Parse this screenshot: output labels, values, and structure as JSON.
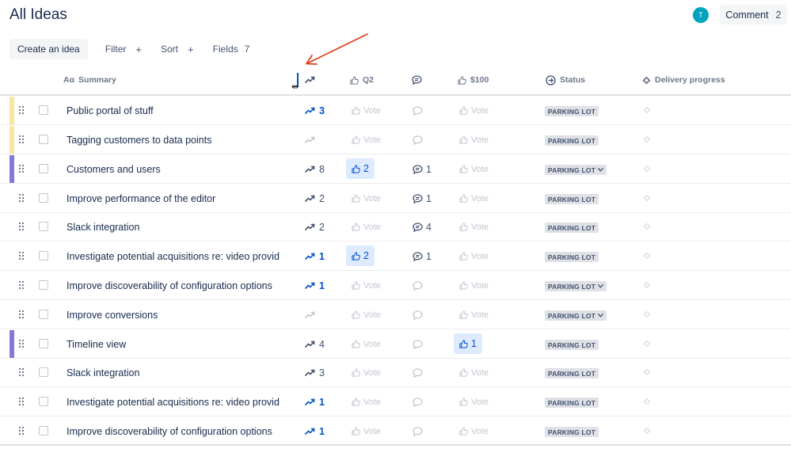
{
  "page": {
    "title": "All Ideas"
  },
  "header_actions": {
    "avatar_initial": "T",
    "comment_label": "Comment",
    "comment_count": "2"
  },
  "toolbar": {
    "create_label": "Create an idea",
    "filter_label": "Filter",
    "filter_plus": "+",
    "sort_label": "Sort",
    "sort_plus": "+",
    "fields_label": "Fields",
    "fields_count": "7"
  },
  "columns": {
    "summary": "Summary",
    "summary_prefix": "Aα",
    "q2": "Q2",
    "usd100": "$100",
    "status": "Status",
    "delivery": "Delivery progress"
  },
  "vote_placeholder": "Vote",
  "colors": {
    "stripe_yellow": "#f8e6a0",
    "stripe_purple": "#8777d9",
    "accent_blue": "#0052cc",
    "annotation_red": "#e2401c"
  },
  "rows": [
    {
      "summary": "Public portal of stuff",
      "stripe": "yellow",
      "trend": "3",
      "trend_blue": true,
      "q2": "",
      "comments": "",
      "usd100": "",
      "status": "PARKING LOT",
      "dropdown": false
    },
    {
      "summary": "Tagging customers to data points",
      "stripe": "yellow",
      "trend": "",
      "trend_blue": false,
      "q2": "",
      "comments": "",
      "usd100": "",
      "status": "PARKING LOT",
      "dropdown": false
    },
    {
      "summary": "Customers and users",
      "stripe": "purple",
      "trend": "8",
      "trend_blue": false,
      "q2": "2",
      "comments": "1",
      "usd100": "",
      "status": "PARKING LOT",
      "dropdown": true
    },
    {
      "summary": "Improve performance of the editor",
      "stripe": "",
      "trend": "2",
      "trend_blue": false,
      "q2": "",
      "comments": "1",
      "usd100": "",
      "status": "PARKING LOT",
      "dropdown": false
    },
    {
      "summary": "Slack integration",
      "stripe": "",
      "trend": "2",
      "trend_blue": false,
      "q2": "",
      "comments": "4",
      "usd100": "",
      "status": "PARKING LOT",
      "dropdown": false
    },
    {
      "summary": "Investigate potential acquisitions re: video provid…",
      "stripe": "",
      "trend": "1",
      "trend_blue": true,
      "q2": "2",
      "comments": "1",
      "usd100": "",
      "status": "PARKING LOT",
      "dropdown": false
    },
    {
      "summary": "Improve discoverability of configuration options",
      "stripe": "",
      "trend": "1",
      "trend_blue": true,
      "q2": "",
      "comments": "",
      "usd100": "",
      "status": "PARKING LOT",
      "dropdown": true
    },
    {
      "summary": "Improve conversions",
      "stripe": "",
      "trend": "",
      "trend_blue": false,
      "q2": "",
      "comments": "",
      "usd100": "",
      "status": "PARKING LOT",
      "dropdown": true
    },
    {
      "summary": "Timeline view",
      "stripe": "purple",
      "trend": "4",
      "trend_blue": false,
      "q2": "",
      "comments": "",
      "usd100": "1",
      "status": "PARKING LOT",
      "dropdown": false
    },
    {
      "summary": "Slack integration",
      "stripe": "",
      "trend": "3",
      "trend_blue": false,
      "q2": "",
      "comments": "",
      "usd100": "",
      "status": "PARKING LOT",
      "dropdown": false
    },
    {
      "summary": "Investigate potential acquisitions re: video provid…",
      "stripe": "",
      "trend": "1",
      "trend_blue": true,
      "q2": "",
      "comments": "",
      "usd100": "",
      "status": "PARKING LOT",
      "dropdown": false
    },
    {
      "summary": "Improve discoverability of configuration options",
      "stripe": "",
      "trend": "1",
      "trend_blue": true,
      "q2": "",
      "comments": "",
      "usd100": "",
      "status": "PARKING LOT",
      "dropdown": false
    }
  ]
}
